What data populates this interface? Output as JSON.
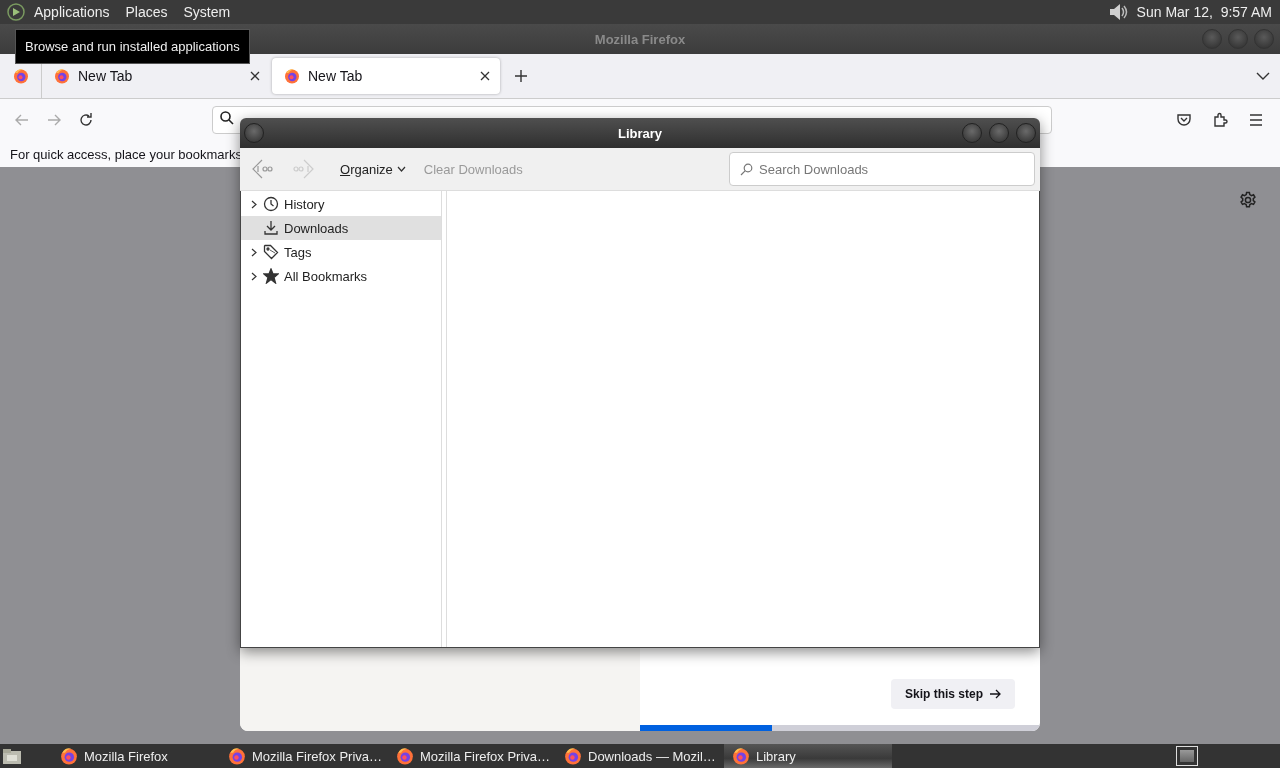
{
  "top_panel": {
    "menus": [
      "Applications",
      "Places",
      "System"
    ],
    "clock": "Sun Mar 12,  9:57 AM"
  },
  "tooltip": "Browse and run installed applications",
  "firefox": {
    "title": "Mozilla Firefox",
    "tabs": [
      {
        "label": "New Tab",
        "selected": false
      },
      {
        "label": "New Tab",
        "selected": true
      }
    ],
    "bookmarks_hint": "For quick access, place your bookmarks",
    "onboarding": {
      "button": "Skip this step",
      "progress": {
        "level": 0.33
      }
    }
  },
  "library": {
    "title": "Library",
    "organize": "Organize",
    "clear": {
      "label": "Clear Downloads",
      "disabled": true
    },
    "search": {
      "placeholder": "Search Downloads"
    },
    "sidebar": [
      {
        "label": "History",
        "kind": "history",
        "expandable": true,
        "selected": false
      },
      {
        "label": "Downloads",
        "kind": "downloads",
        "expandable": false,
        "selected": true
      },
      {
        "label": "Tags",
        "kind": "tags",
        "expandable": true,
        "selected": false
      },
      {
        "label": "All Bookmarks",
        "kind": "bookmarks",
        "expandable": true,
        "selected": false
      }
    ]
  },
  "taskbar": {
    "items": [
      {
        "label": "Mozilla Firefox",
        "selected": false
      },
      {
        "label": "Mozilla Firefox Priva…",
        "selected": false
      },
      {
        "label": "Mozilla Firefox Priva…",
        "selected": false
      },
      {
        "label": "Downloads — Mozil…",
        "selected": false
      },
      {
        "label": "Library",
        "selected": true
      }
    ]
  }
}
